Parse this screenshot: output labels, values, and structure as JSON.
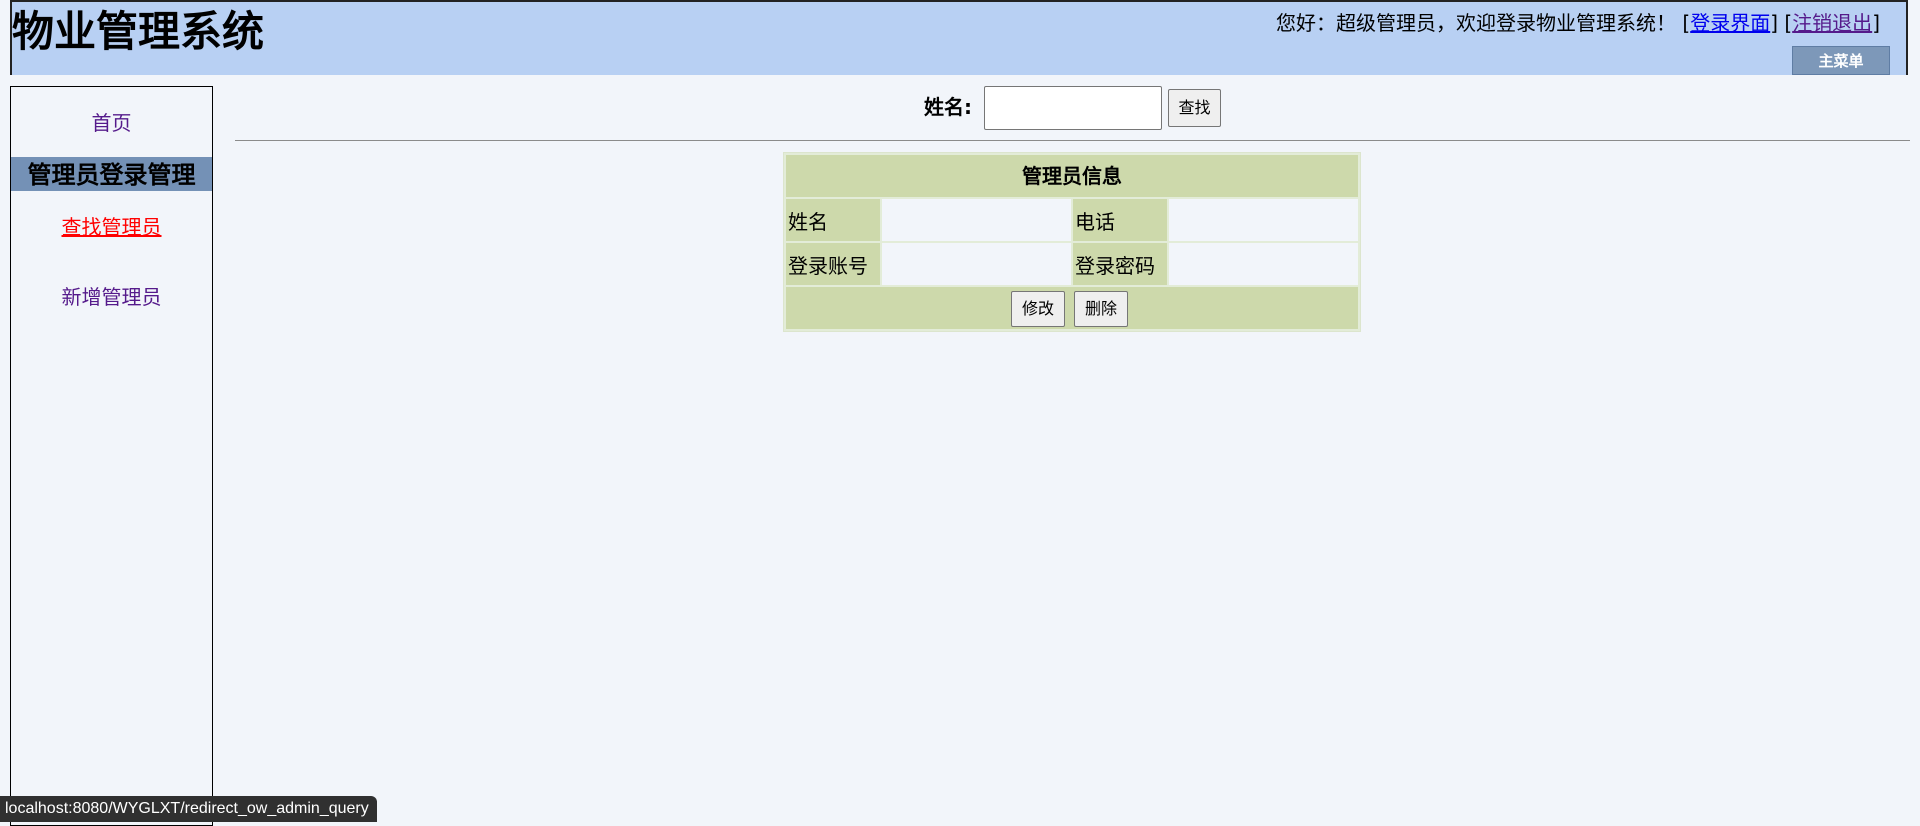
{
  "header": {
    "title": "物业管理系统",
    "welcome_text": "您好：超级管理员，欢迎登录物业管理系统！",
    "login_link_label": "登录界面",
    "logout_link_label": "注销退出",
    "main_menu_label": "主菜单"
  },
  "sidebar": {
    "home_label": "首页",
    "section_title": "管理员登录管理",
    "find_admin_label": "查找管理员",
    "add_admin_label": "新增管理员"
  },
  "search": {
    "label": "姓名:",
    "value": "",
    "button_label": "查找"
  },
  "info_table": {
    "title": "管理员信息",
    "name_label": "姓名",
    "phone_label": "电话",
    "account_label": "登录账号",
    "password_label": "登录密码",
    "name_value": "",
    "phone_value": "",
    "account_value": "",
    "password_value": "",
    "edit_label": "修改",
    "delete_label": "删除"
  },
  "status_bar": {
    "url": "localhost:8080/WYGLXT/redirect_ow_admin_query"
  },
  "colors": {
    "header_background": "#b8d0f3",
    "section_background": "#7491b6",
    "table_header_background": "#cdd9ab",
    "active_link": "#ff0000",
    "visited_link": "#551a8b"
  }
}
